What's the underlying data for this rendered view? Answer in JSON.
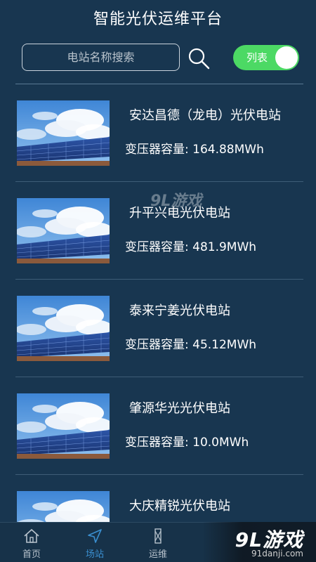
{
  "header": {
    "title": "智能光伏运维平台"
  },
  "search": {
    "placeholder": "电站名称搜索"
  },
  "toggle": {
    "label": "列表",
    "on": true,
    "color": "#4cd964"
  },
  "stations": [
    {
      "name": "安达昌德（龙电）光伏电站",
      "capacity": "变压器容量: 164.88MWh"
    },
    {
      "name": "升平兴电光伏电站",
      "capacity": "变压器容量: 481.9MWh"
    },
    {
      "name": "泰来宁姜光伏电站",
      "capacity": "变压器容量: 45.12MWh"
    },
    {
      "name": "肇源华光光伏电站",
      "capacity": "变压器容量: 10.0MWh"
    },
    {
      "name": "大庆精锐光伏电站",
      "capacity": ""
    }
  ],
  "watermark": {
    "center": "9L游戏",
    "brand": "9L游戏",
    "brand_url": "91danji.com"
  },
  "tabs": [
    {
      "label": "首页",
      "icon": "home-icon",
      "active": false
    },
    {
      "label": "场站",
      "icon": "navigation-icon",
      "active": true
    },
    {
      "label": "运维",
      "icon": "tools-icon",
      "active": false
    }
  ],
  "colors": {
    "background": "#183650",
    "accent": "#3a8fd0"
  }
}
